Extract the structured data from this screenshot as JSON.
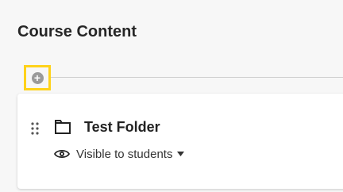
{
  "header": {
    "title": "Course Content"
  },
  "toolbar": {
    "add_icon": "plus-circle-icon"
  },
  "content_item": {
    "type_icon": "folder-icon",
    "title": "Test Folder",
    "visibility": {
      "icon": "eye-icon",
      "label": "Visible to students",
      "dropdown_icon": "caret-down-icon"
    }
  },
  "colors": {
    "highlight": "#ffd21a",
    "background": "#f7f7f7",
    "card": "#ffffff",
    "text": "#222222"
  }
}
